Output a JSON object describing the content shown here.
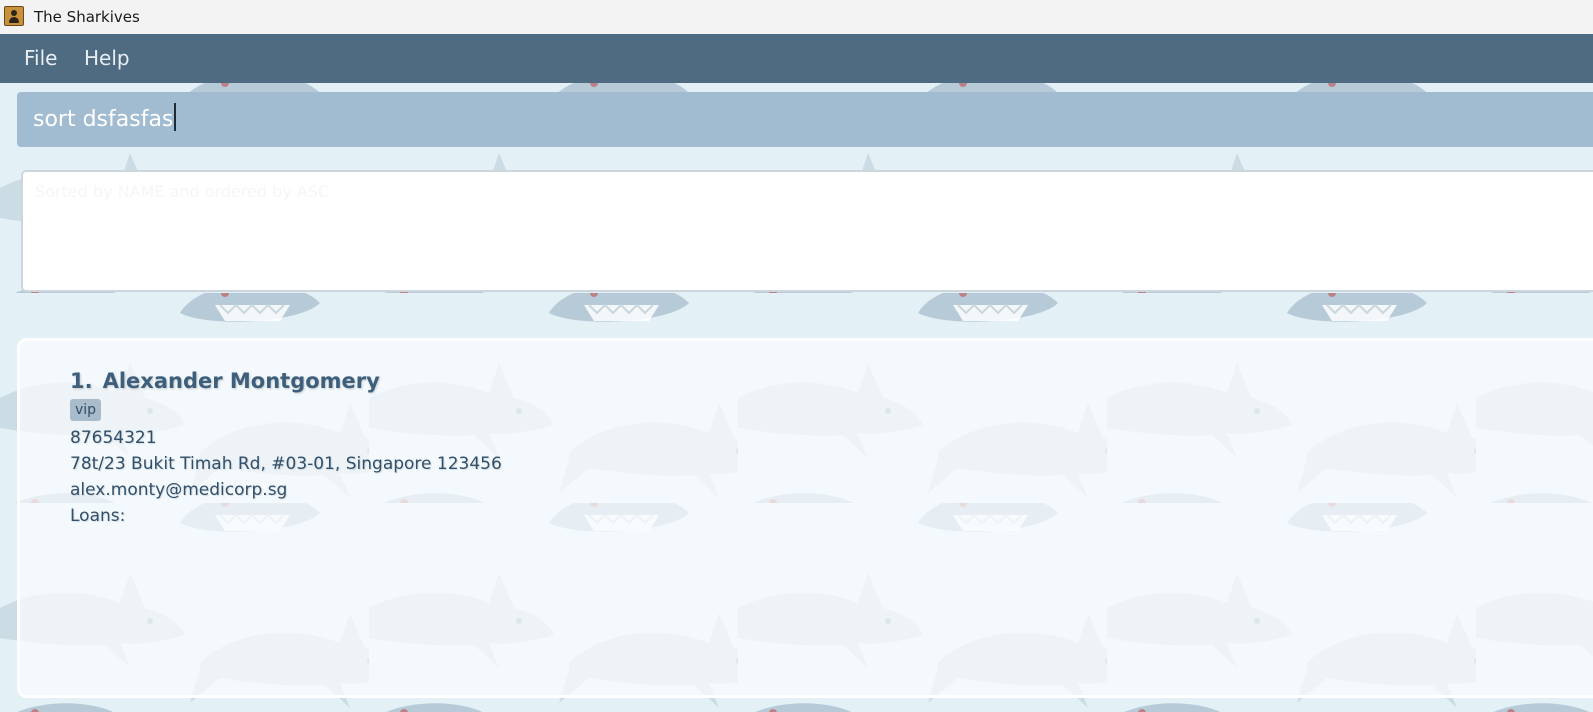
{
  "window": {
    "title": "The Sharkives"
  },
  "menu": {
    "items": [
      "File",
      "Help"
    ]
  },
  "command": {
    "value": "sort dsfasfas"
  },
  "result": {
    "message": "Sorted by NAME and ordered by ASC"
  },
  "persons": [
    {
      "index": "1.",
      "name": "Alexander Montgomery",
      "tags": [
        "vip"
      ],
      "phone": "87654321",
      "address": "78t/23 Bukit Timah Rd, #03-01, Singapore 123456",
      "email": "alex.monty@medicorp.sg",
      "loans_label": "Loans:"
    }
  ],
  "colors": {
    "menubar": "#4e6b82",
    "command_box": "#a1bbd1",
    "background": "#e3f1f6",
    "name_text": "#3e5f7c"
  },
  "icons": {
    "app": "contacts-book-icon",
    "wallpaper": "shark-icon"
  }
}
